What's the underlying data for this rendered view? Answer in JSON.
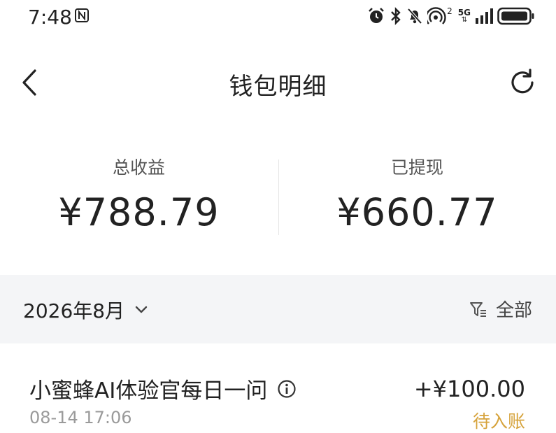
{
  "status_bar": {
    "time": "7:48",
    "network_label": "5G",
    "hotspot_count": "2",
    "icons": [
      "nfc-icon",
      "alarm-icon",
      "bluetooth-icon",
      "mute-icon",
      "hotspot-icon",
      "signal-icon",
      "battery-icon"
    ]
  },
  "header": {
    "title": "钱包明细",
    "back_icon": "chevron-left-icon",
    "refresh_icon": "refresh-icon"
  },
  "summary": {
    "total_label": "总收益",
    "total_value": "¥788.79",
    "withdrawn_label": "已提现",
    "withdrawn_value": "¥660.77"
  },
  "filter": {
    "month": "2026年8月",
    "month_icon": "chevron-down-icon",
    "filter_label": "全部",
    "filter_icon": "filter-icon"
  },
  "transactions": [
    {
      "title": "小蜜蜂AI体验官每日一问",
      "time": "08-14 17:06",
      "amount": "+¥100.00",
      "status": "待入账",
      "status_color": "#d6a33c"
    }
  ]
}
